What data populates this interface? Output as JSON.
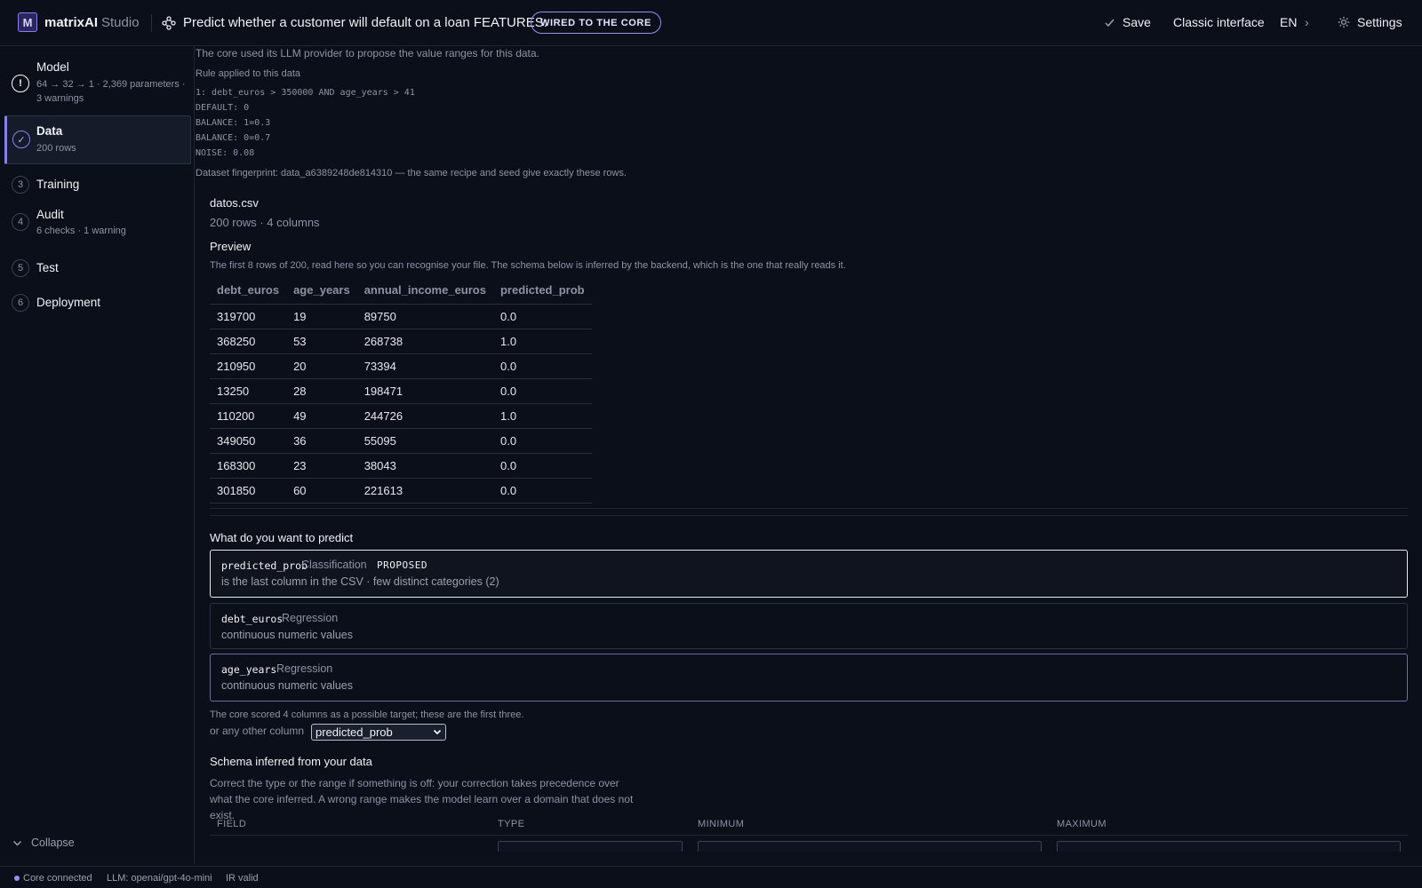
{
  "app": {
    "logo_letter": "M",
    "brand": "matrixAI",
    "brand_sub": "Studio",
    "project_title": "Predict whether a customer will default on a loan FEATURES:",
    "core_badge": "WIRED TO THE CORE",
    "accent_color": "#8b7ff0"
  },
  "toolbar": {
    "save_label": "Save",
    "classic_label": "Classic interface",
    "lang_label": "EN",
    "settings_label": "Settings"
  },
  "sidebar": {
    "steps": [
      {
        "num": "!",
        "title": "Model",
        "sub": "64 → 32 → 1 · 2,369 parameters · 3 warnings",
        "status": "warning"
      },
      {
        "num": "✓",
        "title": "Data",
        "sub": "200 rows",
        "status": "done-active"
      },
      {
        "num": "3",
        "title": "Training",
        "sub": ""
      },
      {
        "num": "4",
        "title": "Audit",
        "sub": "6 checks · 1 warning"
      },
      {
        "num": "5",
        "title": "Test",
        "sub": ""
      },
      {
        "num": "6",
        "title": "Deployment",
        "sub": ""
      }
    ],
    "collapse_label": "Collapse"
  },
  "main": {
    "llm_note": "The core used its LLM provider to propose the value ranges for this data.",
    "rule_heading": "Rule applied to this data",
    "rule_lines": [
      "1: debt_euros > 350000 AND age_years > 41",
      "DEFAULT: 0",
      "BALANCE: 1=0.3",
      "BALANCE: 0=0.7",
      "NOISE: 0.08"
    ],
    "fingerprint": "Dataset fingerprint: data_a6389248de814310 — the same recipe and seed give exactly these rows.",
    "file_name": "datos.csv",
    "file_meta": "200 rows · 4 columns",
    "preview_title": "Preview",
    "preview_note": "The first 8 rows of 200, read here so you can recognise your file. The schema below is inferred by the backend, which is the one that really reads it.",
    "preview_columns": [
      "debt_euros",
      "age_years",
      "annual_income_euros",
      "predicted_prob"
    ],
    "preview_rows": [
      [
        "319700",
        "19",
        "89750",
        "0.0"
      ],
      [
        "368250",
        "53",
        "268738",
        "1.0"
      ],
      [
        "210950",
        "20",
        "73394",
        "0.0"
      ],
      [
        "13250",
        "28",
        "198471",
        "0.0"
      ],
      [
        "110200",
        "49",
        "244726",
        "1.0"
      ],
      [
        "349050",
        "36",
        "55095",
        "0.0"
      ],
      [
        "168300",
        "23",
        "38043",
        "0.0"
      ],
      [
        "301850",
        "60",
        "221613",
        "0.0"
      ]
    ],
    "predict_title": "What do you want to predict",
    "targets": [
      {
        "name": "predicted_prob",
        "kind": "Classification",
        "tag": "PROPOSED",
        "desc": "is the last column in the CSV · few distinct categories (2)"
      },
      {
        "name": "debt_euros",
        "kind": "Regression",
        "tag": "",
        "desc": "continuous numeric values"
      },
      {
        "name": "age_years",
        "kind": "Regression",
        "tag": "",
        "desc": "continuous numeric values"
      }
    ],
    "scored_note": "The core scored 4 columns as a possible target; these are the first three.",
    "other_column_label": "or any other column",
    "other_column_value": "predicted_prob",
    "schema_title": "Schema inferred from your data",
    "schema_note": "Correct the type or the range if something is off: your correction takes precedence over what the core inferred. A wrong range makes the model learn over a domain that does not exist.",
    "schema_columns": [
      "FIELD",
      "TYPE",
      "MINIMUM",
      "MAXIMUM"
    ]
  },
  "status": {
    "core": "Core connected",
    "llm": "LLM: openai/gpt-4o-mini",
    "ir": "IR valid"
  }
}
